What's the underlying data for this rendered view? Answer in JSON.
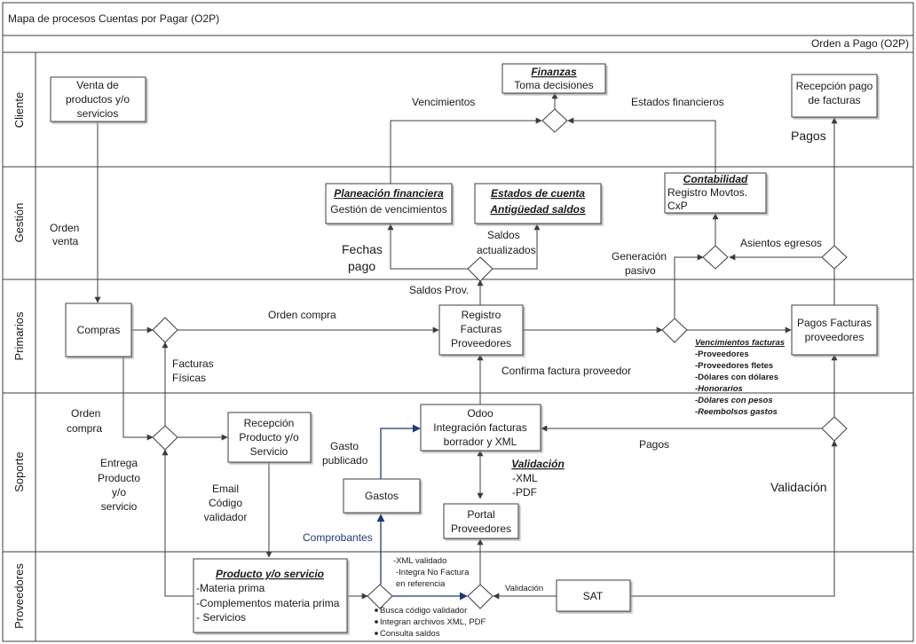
{
  "title": "Mapa de procesos Cuentas por Pagar (O2P)",
  "subtitle": "Orden a Pago (O2P)",
  "lanes": [
    "Cliente",
    "Gestión",
    "Primarios",
    "Soporte",
    "Proveedores"
  ],
  "nodes": {
    "venta": [
      "Venta de",
      "productos y/o",
      "servicios"
    ],
    "finanzas": {
      "header": "Finanzas",
      "lines": [
        "Toma decisiones"
      ]
    },
    "recepcion_pago": [
      "Recepción pago",
      "de facturas"
    ],
    "planeacion": {
      "header": "Planeación financiera",
      "lines": [
        "Gestión de vencimientos"
      ]
    },
    "estados_cuenta": {
      "header1": "Estados de cuenta",
      "header2": "Antigüedad saldos"
    },
    "contabilidad": {
      "header": "Contabilidad",
      "lines": [
        "Registro  Movtos.",
        "CxP"
      ]
    },
    "compras": "Compras",
    "registro": [
      "Registro",
      "Facturas",
      "Proveedores"
    ],
    "pagos_facturas": [
      "Pagos Facturas",
      "proveedores"
    ],
    "recepcion_producto": [
      "Recepción",
      "Producto y/o",
      "Servicio"
    ],
    "odoo": [
      "Odoo",
      "Integración facturas",
      "borrador y XML"
    ],
    "gastos": "Gastos",
    "portal": [
      "Portal",
      "Proveedores"
    ],
    "producto": {
      "header": "Producto y/o servicio",
      "lines": [
        "-Materia prima",
        "-Complementos materia prima",
        "- Servicios"
      ]
    },
    "sat": "SAT"
  },
  "labels": {
    "vencimientos": "Vencimientos",
    "estados_financieros": "Estados financieros",
    "pagos_top": "Pagos",
    "orden_venta": [
      "Orden",
      "venta"
    ],
    "fechas_pago": [
      "Fechas",
      "pago"
    ],
    "saldos_actualizados": [
      "Saldos",
      "actualizados"
    ],
    "generacion_pasivo": [
      "Generación",
      "pasivo"
    ],
    "asientos_egresos": "Asientos egresos",
    "saldos_prov": "Saldos Prov.",
    "orden_compra": "Orden compra",
    "facturas_fisicas": [
      "Facturas",
      "Físicas"
    ],
    "confirma_factura": "Confirma  factura  proveedor",
    "orden_compra_2": [
      "Orden",
      "compra"
    ],
    "entrega_producto": [
      "Entrega",
      "Producto",
      "y/o",
      "servicio"
    ],
    "gasto_publicado": [
      "Gasto",
      "publicado"
    ],
    "pagos_mid": "Pagos",
    "validacion_big": "Validación",
    "email_codigo": [
      "Email",
      "Código",
      "validador"
    ],
    "comprobantes": "Comprobantes",
    "validacion_small": "Validación",
    "validacion_xml": {
      "header": "Validación",
      "lines": [
        "-XML",
        "-PDF"
      ]
    },
    "xml_notes": [
      "-XML validado",
      "-Integra No Factura",
      "en referencia"
    ],
    "bullets": [
      "Busca código validador",
      "Integran archivos XML, PDF",
      "Consulta saldos"
    ]
  },
  "vencimientos_facturas": {
    "header": "Vencimientos  facturas",
    "items": [
      "-Proveedores",
      "-Proveedores fletes",
      "-Dólares con dólares",
      "-Honorarios",
      "-Dólares con pesos",
      "-Reembolsos gastos"
    ]
  },
  "colors": {
    "line": "#3c3c3c",
    "accent_blue": "#1f3a78"
  }
}
